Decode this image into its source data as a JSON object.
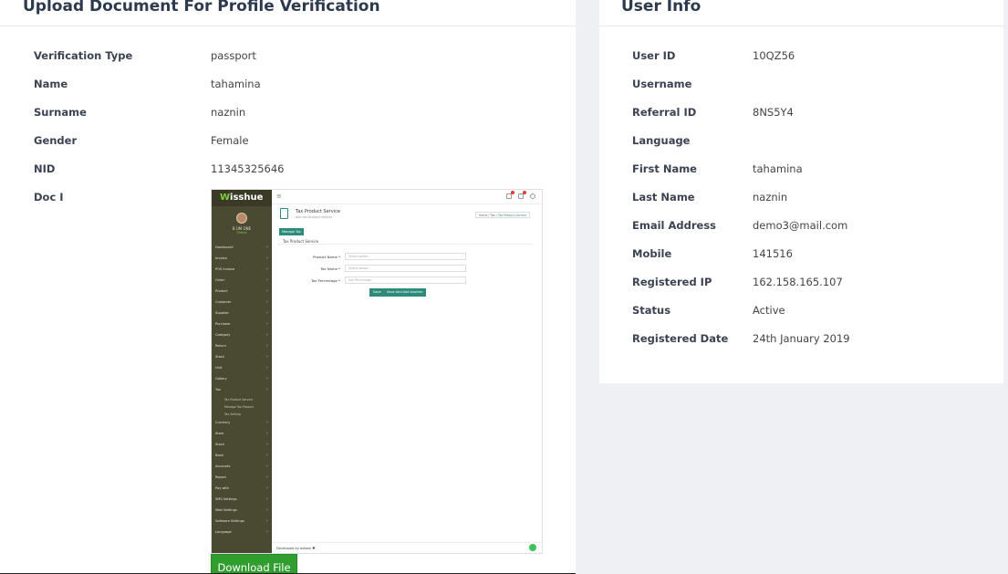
{
  "left_card": {
    "title": "Upload Document For Profile Verification",
    "fields": [
      {
        "label": "Verification Type",
        "value": "passport"
      },
      {
        "label": "Name",
        "value": "tahamina"
      },
      {
        "label": "Surname",
        "value": "naznin"
      },
      {
        "label": "Gender",
        "value": "Female"
      },
      {
        "label": "NID",
        "value": "11345325646"
      },
      {
        "label": "Doc I",
        "value": ""
      }
    ],
    "download_label": "Download File"
  },
  "right_card": {
    "title": "User Info",
    "fields": [
      {
        "label": "User ID",
        "value": "10QZ56"
      },
      {
        "label": "Username",
        "value": ""
      },
      {
        "label": "Referral ID",
        "value": "8NS5Y4"
      },
      {
        "label": "Language",
        "value": ""
      },
      {
        "label": "First Name",
        "value": "tahamina"
      },
      {
        "label": "Last Name",
        "value": "naznin"
      },
      {
        "label": "Email Address",
        "value": "demo3@mail.com"
      },
      {
        "label": "Mobile",
        "value": "141516"
      },
      {
        "label": "Registered IP",
        "value": "162.158.165.107"
      },
      {
        "label": "Status",
        "value": "Active"
      },
      {
        "label": "Registered Date",
        "value": "24th January 2019"
      }
    ]
  },
  "document": {
    "logo_prefix": "W",
    "logo_rest": "isshue",
    "user_name": "B UM ONE",
    "user_status": "Online",
    "menu": [
      "Dashboard",
      "Invoice",
      "POS Invoice",
      "Order",
      "Product",
      "Customer",
      "Supplier",
      "Purchase",
      "Category",
      "Return",
      "Stock",
      "Unit",
      "Gallery",
      "Tax",
      "Currency",
      "Store",
      "Stock",
      "Bank",
      "Accounts",
      "Report",
      "Pay with",
      "SMS Settings",
      "Web Settings",
      "Software Settings",
      "Language"
    ],
    "tax_submenu": [
      "Tax Product Service",
      "Manage Tax Product",
      "Tax Setting"
    ],
    "page_title": "Tax Product Service",
    "page_subtitle": "Add tax product service",
    "breadcrumb_home": "Home",
    "breadcrumb_mid": "Tax",
    "breadcrumb_current": "Tax Product Service",
    "manage_button": "Manage Tax",
    "section_title": "Tax Product Service",
    "form": [
      {
        "label": "Product Name *",
        "placeholder": "Select option"
      },
      {
        "label": "Tax Name *",
        "placeholder": "Select option"
      },
      {
        "label": "Tax Percentage *",
        "placeholder": "Tax Percentage"
      }
    ],
    "save_button": "Save",
    "save_another_button": "Save And Add Another",
    "footer": "Developed by bdtask ♥"
  },
  "colors": {
    "accent": "#2e8b7a",
    "download_green": "#2f9e2f",
    "sidebar": "#4a4a32"
  }
}
